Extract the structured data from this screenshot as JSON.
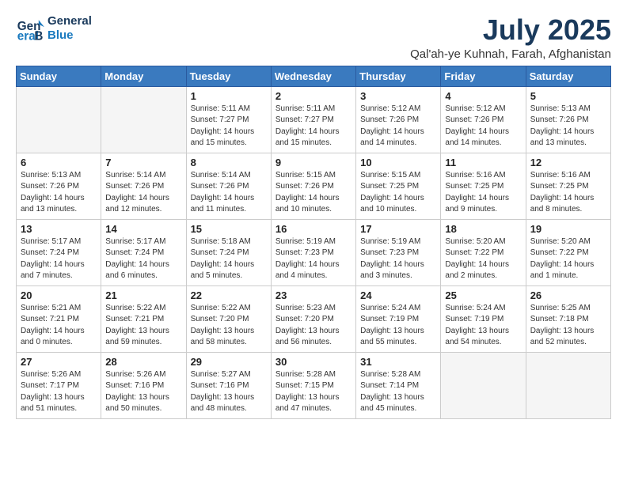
{
  "logo": {
    "line1": "General",
    "line2": "Blue"
  },
  "title": "July 2025",
  "subtitle": "Qal'ah-ye Kuhnah, Farah, Afghanistan",
  "days_header": [
    "Sunday",
    "Monday",
    "Tuesday",
    "Wednesday",
    "Thursday",
    "Friday",
    "Saturday"
  ],
  "weeks": [
    [
      {
        "day": "",
        "info": ""
      },
      {
        "day": "",
        "info": ""
      },
      {
        "day": "1",
        "info": "Sunrise: 5:11 AM\nSunset: 7:27 PM\nDaylight: 14 hours and 15 minutes."
      },
      {
        "day": "2",
        "info": "Sunrise: 5:11 AM\nSunset: 7:27 PM\nDaylight: 14 hours and 15 minutes."
      },
      {
        "day": "3",
        "info": "Sunrise: 5:12 AM\nSunset: 7:26 PM\nDaylight: 14 hours and 14 minutes."
      },
      {
        "day": "4",
        "info": "Sunrise: 5:12 AM\nSunset: 7:26 PM\nDaylight: 14 hours and 14 minutes."
      },
      {
        "day": "5",
        "info": "Sunrise: 5:13 AM\nSunset: 7:26 PM\nDaylight: 14 hours and 13 minutes."
      }
    ],
    [
      {
        "day": "6",
        "info": "Sunrise: 5:13 AM\nSunset: 7:26 PM\nDaylight: 14 hours and 13 minutes."
      },
      {
        "day": "7",
        "info": "Sunrise: 5:14 AM\nSunset: 7:26 PM\nDaylight: 14 hours and 12 minutes."
      },
      {
        "day": "8",
        "info": "Sunrise: 5:14 AM\nSunset: 7:26 PM\nDaylight: 14 hours and 11 minutes."
      },
      {
        "day": "9",
        "info": "Sunrise: 5:15 AM\nSunset: 7:26 PM\nDaylight: 14 hours and 10 minutes."
      },
      {
        "day": "10",
        "info": "Sunrise: 5:15 AM\nSunset: 7:25 PM\nDaylight: 14 hours and 10 minutes."
      },
      {
        "day": "11",
        "info": "Sunrise: 5:16 AM\nSunset: 7:25 PM\nDaylight: 14 hours and 9 minutes."
      },
      {
        "day": "12",
        "info": "Sunrise: 5:16 AM\nSunset: 7:25 PM\nDaylight: 14 hours and 8 minutes."
      }
    ],
    [
      {
        "day": "13",
        "info": "Sunrise: 5:17 AM\nSunset: 7:24 PM\nDaylight: 14 hours and 7 minutes."
      },
      {
        "day": "14",
        "info": "Sunrise: 5:17 AM\nSunset: 7:24 PM\nDaylight: 14 hours and 6 minutes."
      },
      {
        "day": "15",
        "info": "Sunrise: 5:18 AM\nSunset: 7:24 PM\nDaylight: 14 hours and 5 minutes."
      },
      {
        "day": "16",
        "info": "Sunrise: 5:19 AM\nSunset: 7:23 PM\nDaylight: 14 hours and 4 minutes."
      },
      {
        "day": "17",
        "info": "Sunrise: 5:19 AM\nSunset: 7:23 PM\nDaylight: 14 hours and 3 minutes."
      },
      {
        "day": "18",
        "info": "Sunrise: 5:20 AM\nSunset: 7:22 PM\nDaylight: 14 hours and 2 minutes."
      },
      {
        "day": "19",
        "info": "Sunrise: 5:20 AM\nSunset: 7:22 PM\nDaylight: 14 hours and 1 minute."
      }
    ],
    [
      {
        "day": "20",
        "info": "Sunrise: 5:21 AM\nSunset: 7:21 PM\nDaylight: 14 hours and 0 minutes."
      },
      {
        "day": "21",
        "info": "Sunrise: 5:22 AM\nSunset: 7:21 PM\nDaylight: 13 hours and 59 minutes."
      },
      {
        "day": "22",
        "info": "Sunrise: 5:22 AM\nSunset: 7:20 PM\nDaylight: 13 hours and 58 minutes."
      },
      {
        "day": "23",
        "info": "Sunrise: 5:23 AM\nSunset: 7:20 PM\nDaylight: 13 hours and 56 minutes."
      },
      {
        "day": "24",
        "info": "Sunrise: 5:24 AM\nSunset: 7:19 PM\nDaylight: 13 hours and 55 minutes."
      },
      {
        "day": "25",
        "info": "Sunrise: 5:24 AM\nSunset: 7:19 PM\nDaylight: 13 hours and 54 minutes."
      },
      {
        "day": "26",
        "info": "Sunrise: 5:25 AM\nSunset: 7:18 PM\nDaylight: 13 hours and 52 minutes."
      }
    ],
    [
      {
        "day": "27",
        "info": "Sunrise: 5:26 AM\nSunset: 7:17 PM\nDaylight: 13 hours and 51 minutes."
      },
      {
        "day": "28",
        "info": "Sunrise: 5:26 AM\nSunset: 7:16 PM\nDaylight: 13 hours and 50 minutes."
      },
      {
        "day": "29",
        "info": "Sunrise: 5:27 AM\nSunset: 7:16 PM\nDaylight: 13 hours and 48 minutes."
      },
      {
        "day": "30",
        "info": "Sunrise: 5:28 AM\nSunset: 7:15 PM\nDaylight: 13 hours and 47 minutes."
      },
      {
        "day": "31",
        "info": "Sunrise: 5:28 AM\nSunset: 7:14 PM\nDaylight: 13 hours and 45 minutes."
      },
      {
        "day": "",
        "info": ""
      },
      {
        "day": "",
        "info": ""
      }
    ]
  ]
}
